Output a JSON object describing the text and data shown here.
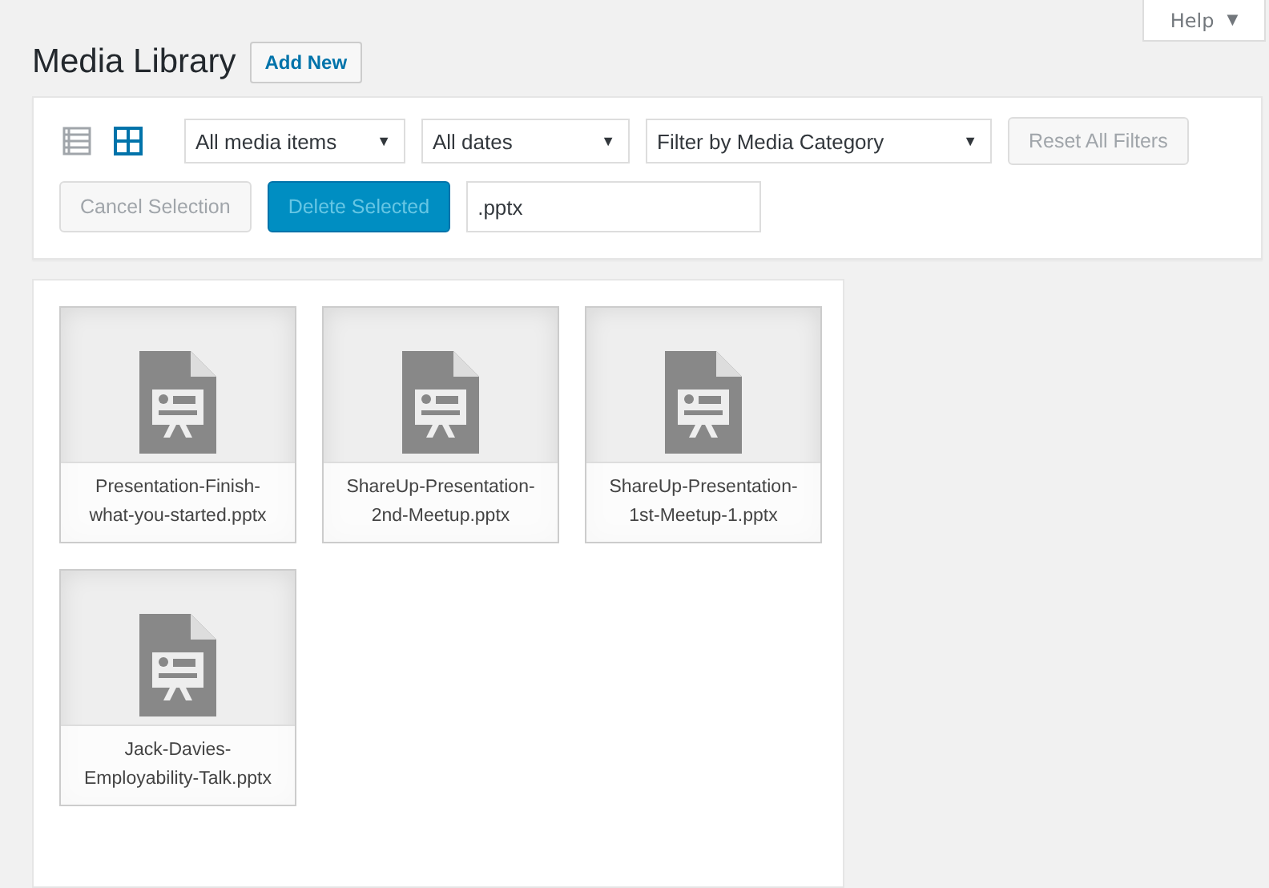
{
  "help_tab": {
    "label": "Help",
    "caret": "▼"
  },
  "page_title": "Media Library",
  "add_new_button": "Add New",
  "toolbar": {
    "view_modes": [
      {
        "kind": "list",
        "selected": false
      },
      {
        "kind": "grid",
        "selected": true
      }
    ],
    "filters": [
      {
        "value": "All media items",
        "caret": "▼"
      },
      {
        "value": "All dates",
        "caret": "▼"
      },
      {
        "value": "Filter by Media Category",
        "caret": "▼"
      }
    ],
    "reset_button": {
      "label": "Reset All Filters",
      "disabled": true
    },
    "cancel_button": {
      "label": "Cancel Selection",
      "disabled": true
    },
    "delete_button": {
      "label": "Delete Selected",
      "disabled": true
    },
    "search": {
      "value": ".pptx"
    }
  },
  "attachments": [
    {
      "filename": "Presentation-Finish-what-you-started.pptx"
    },
    {
      "filename": "ShareUp-Presentation-2nd-Meetup.pptx"
    },
    {
      "filename": "ShareUp-Presentation-1st-Meetup-1.pptx"
    },
    {
      "filename": "Jack-Davies-Employability-Talk.pptx"
    }
  ]
}
